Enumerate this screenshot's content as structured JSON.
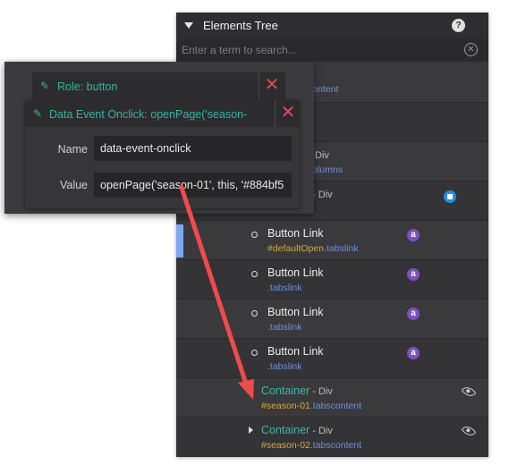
{
  "tree": {
    "title": "Elements Tree",
    "help": "?",
    "search_placeholder": "Enter a term to search...",
    "rows": [
      {
        "name": "",
        "type": "",
        "id": "",
        "cls": "content"
      },
      {
        "name": "",
        "type": "",
        "id": "",
        "cls": ""
      },
      {
        "name": "",
        "type": "Div",
        "id": "",
        "cls": "columns"
      },
      {
        "name": "",
        "type": "- Div",
        "id": "",
        "cls": "s"
      },
      {
        "name": "Button Link",
        "type": "",
        "id": "#defaultOpen",
        "cls": ".tabslink",
        "badge": "a"
      },
      {
        "name": "Button Link",
        "type": "",
        "id": "",
        "cls": ".tabslink",
        "badge": "a"
      },
      {
        "name": "Button Link",
        "type": "",
        "id": "",
        "cls": ".tabslink",
        "badge": "a"
      },
      {
        "name": "Button Link",
        "type": "",
        "id": "",
        "cls": ".tabslink",
        "badge": "a"
      },
      {
        "name": "Container",
        "type": " - Div",
        "id": "#season-01",
        "cls": ".tabscontent"
      },
      {
        "name": "Container",
        "type": " - Div",
        "id": "#season-02",
        "cls": ".tabscontent"
      }
    ]
  },
  "props": {
    "role_label": "Role: button",
    "event_label": "Data Event Onclick: openPage('season-",
    "name_label": "Name",
    "name_value": "data-event-onclick",
    "value_label": "Value",
    "value_value": "openPage('season-01', this, '#884bf5"
  },
  "colors": {
    "accent": "#31b6a2",
    "arrow": "#ef4b4b",
    "badge": "#7e4ec2"
  }
}
